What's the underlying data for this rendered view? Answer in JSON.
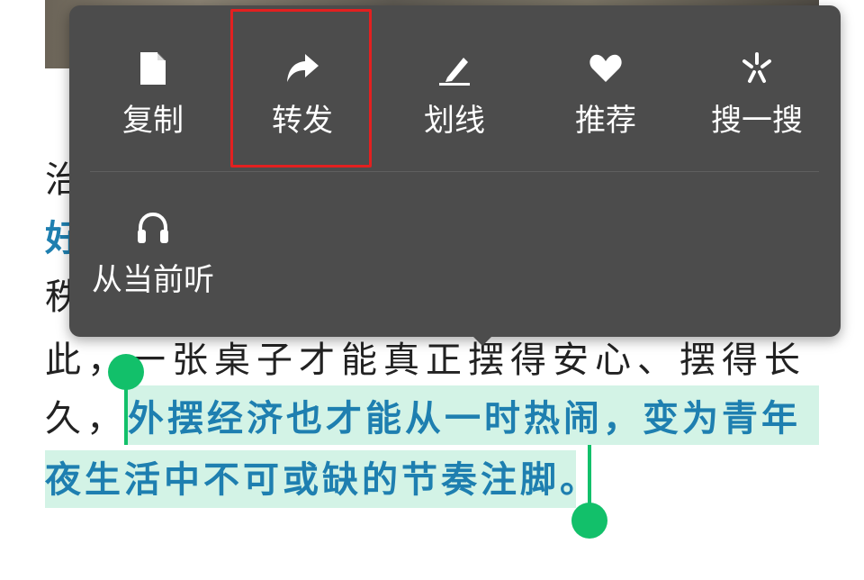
{
  "menu": {
    "row1": [
      {
        "label": "复制",
        "icon": "copy-icon"
      },
      {
        "label": "转发",
        "icon": "forward-icon"
      },
      {
        "label": "划线",
        "icon": "underline-pen-icon"
      },
      {
        "label": "推荐",
        "icon": "heart-icon"
      },
      {
        "label": "搜一搜",
        "icon": "search-spark-icon"
      }
    ],
    "row2": [
      {
        "label": "从当前听",
        "icon": "headphones-icon"
      }
    ],
    "highlighted_item": "转发",
    "highlight_color": "#e32020"
  },
  "article": {
    "line1_fragment": "治",
    "line2_fragment": "好",
    "line3_fragment": "秩",
    "line4": "此，一张桌子才能真正摆得安心、摆得长",
    "line5_prefix": "久，",
    "selected_line1": "外摆经济也才能从一时热闹，变为青年",
    "selected_line2": "夜生活中不可或缺的节奏注脚。"
  },
  "colors": {
    "menu_bg": "#4c4c4c",
    "selection_bg": "#d3f3e6",
    "selected_text": "#1e7fb0",
    "handle": "#12c06a"
  }
}
